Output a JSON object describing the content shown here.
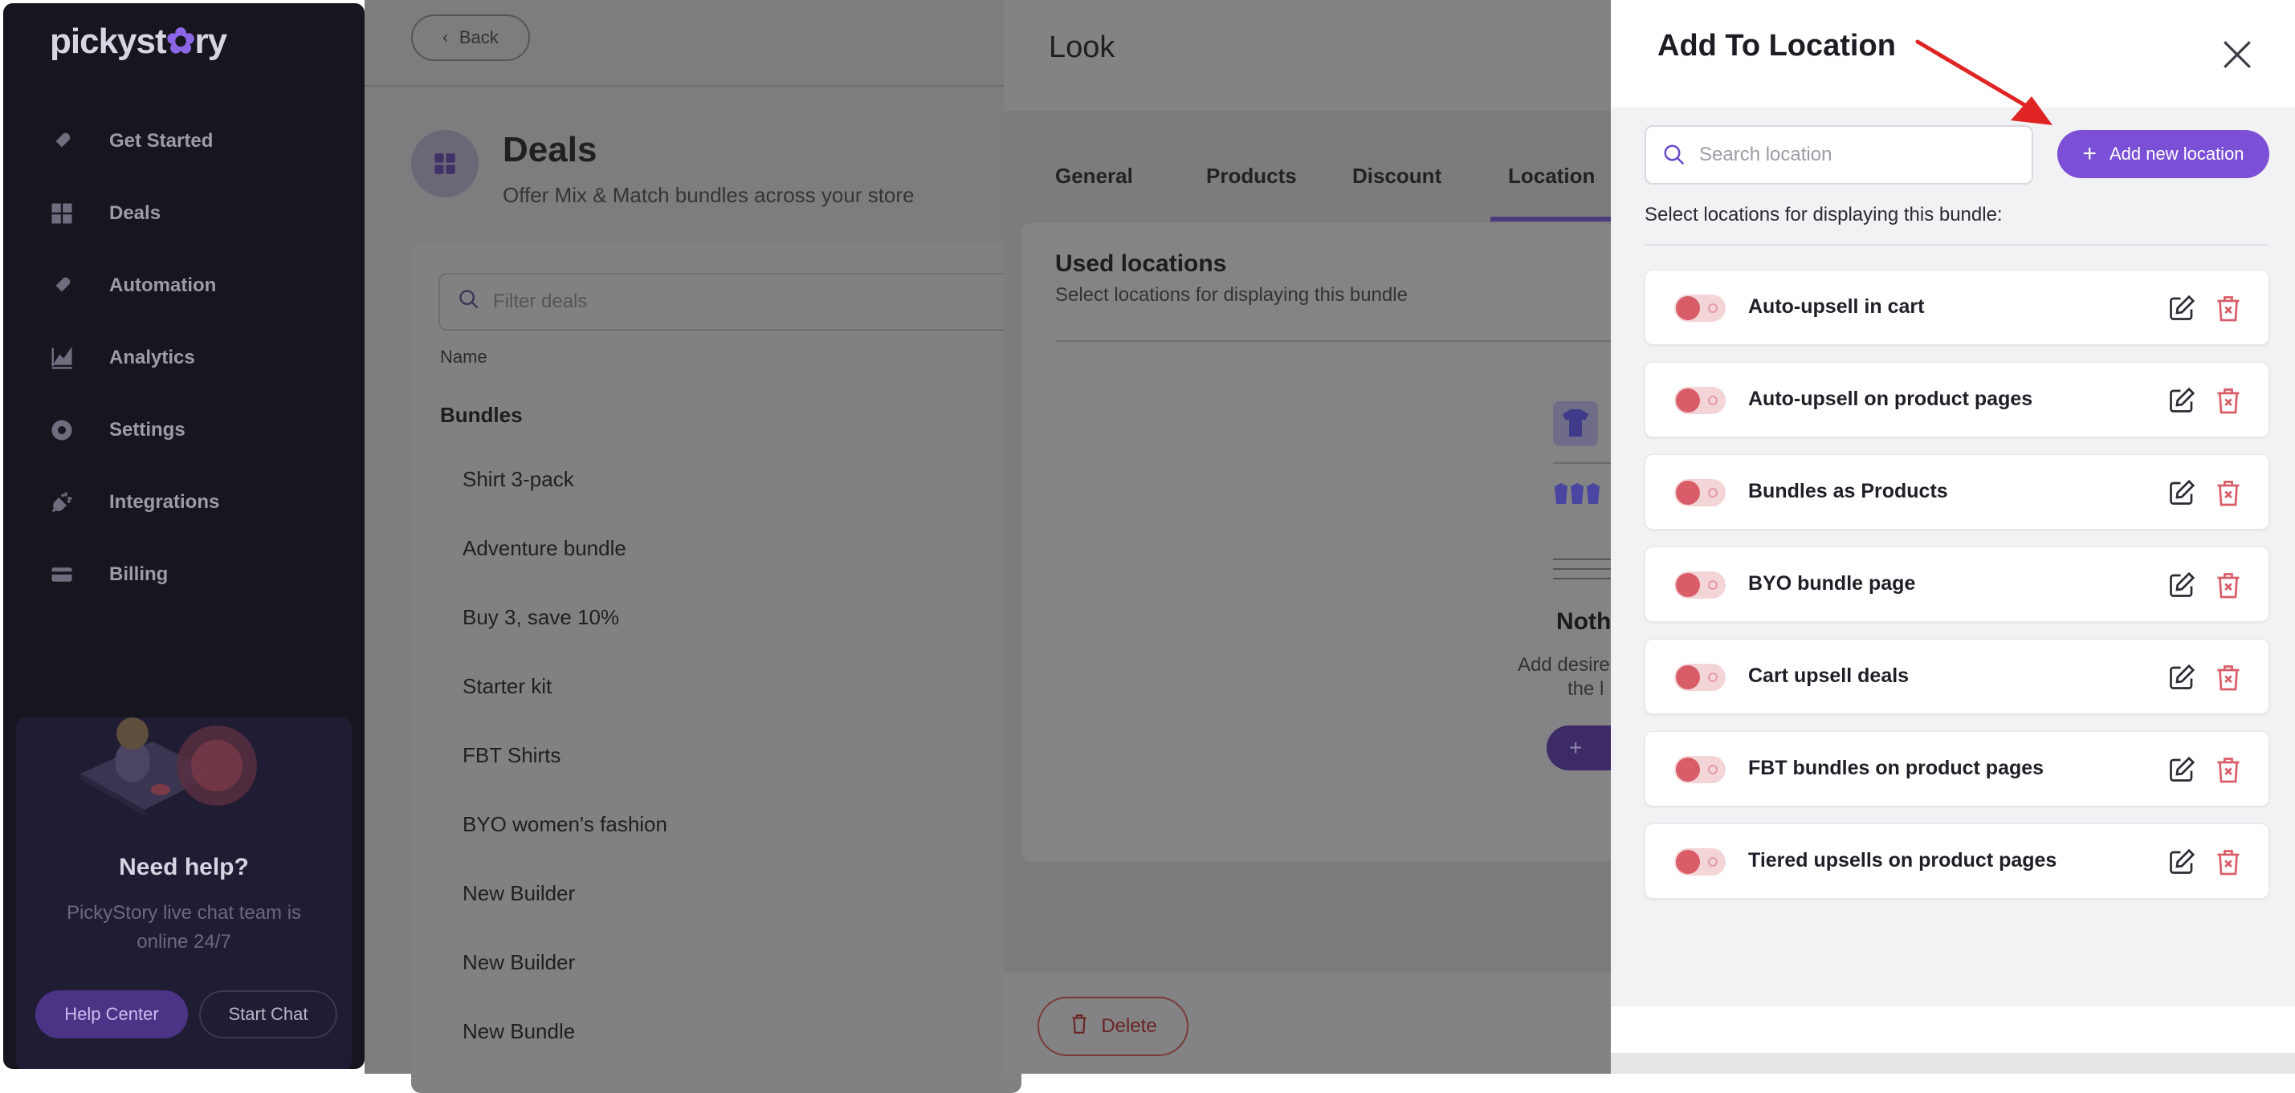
{
  "sidebar": {
    "logo": "pickystory",
    "items": [
      {
        "label": "Get Started",
        "icon": "rocket-icon"
      },
      {
        "label": "Deals",
        "icon": "grid-icon"
      },
      {
        "label": "Automation",
        "icon": "rocket-icon"
      },
      {
        "label": "Analytics",
        "icon": "chart-icon"
      },
      {
        "label": "Settings",
        "icon": "gear-icon"
      },
      {
        "label": "Integrations",
        "icon": "plug-icon"
      },
      {
        "label": "Billing",
        "icon": "card-icon"
      }
    ],
    "help": {
      "title": "Need help?",
      "subtitle": "PickyStory live chat team is online 24/7",
      "help_center": "Help Center",
      "start_chat": "Start Chat"
    }
  },
  "main": {
    "back_label": "Back",
    "title": "Deals",
    "subtitle": "Offer Mix & Match bundles across your store",
    "filter_placeholder": "Filter deals",
    "column_name": "Name",
    "group_label": "Bundles",
    "deals": [
      "Shirt 3-pack",
      "Adventure bundle",
      "Buy 3, save 10%",
      "Starter kit",
      "FBT Shirts",
      "BYO women's fashion",
      "New Builder",
      "New Builder",
      "New Bundle"
    ]
  },
  "look": {
    "title": "Look",
    "tabs": [
      "General",
      "Products",
      "Discount",
      "Location"
    ],
    "active_tab": "Location",
    "used_title": "Used locations",
    "used_subtitle": "Select locations for displaying this bundle",
    "empty_title": "Noth",
    "empty_line1": "Add desire",
    "empty_line2": "the l",
    "delete_label": "Delete"
  },
  "modal": {
    "title": "Add To Location",
    "search_placeholder": "Search location",
    "add_button": "Add new location",
    "select_text": "Select locations for displaying this bundle:",
    "locations": [
      "Auto-upsell in cart",
      "Auto-upsell on product pages",
      "Bundles as Products",
      "BYO bundle page",
      "Cart upsell deals",
      "FBT bundles on product pages",
      "Tiered upsells on product pages"
    ],
    "toggles_enabled": [
      false,
      false,
      false,
      false,
      false,
      false,
      false
    ]
  },
  "colors": {
    "accent": "#7b4fd6",
    "annotation_arrow": "#e02424",
    "delete": "#d95d68"
  }
}
